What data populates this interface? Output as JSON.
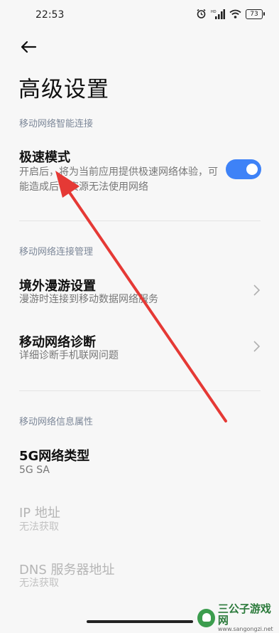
{
  "status": {
    "time": "22:53",
    "battery": "73"
  },
  "header": {
    "back_icon": "arrow-left-icon",
    "title": "高级设置"
  },
  "sections": {
    "smart_connect": {
      "header": "移动网络智能连接",
      "speed_mode": {
        "title": "极速模式",
        "subtitle": "开启后，将为当前应用提供极速网络体验，可能造成后台资源无法使用网络",
        "enabled": true
      }
    },
    "connect_mgmt": {
      "header": "移动网络连接管理",
      "roaming": {
        "title": "境外漫游设置",
        "subtitle": "漫游时连接到移动数据网络服务"
      },
      "diagnosis": {
        "title": "移动网络诊断",
        "subtitle": "详细诊断手机联网问题"
      }
    },
    "info": {
      "header": "移动网络信息属性",
      "network_type": {
        "title": "5G网络类型",
        "value": "5G SA"
      },
      "ip": {
        "title": "IP 地址",
        "value": "无法获取"
      },
      "dns": {
        "title": "DNS 服务器地址",
        "value": "无法获取"
      }
    }
  },
  "watermark": {
    "name": "三公子游戏网",
    "url": "www.sangongzi.net"
  },
  "colors": {
    "accent": "#3e82f7",
    "annotation_arrow": "#e53935"
  }
}
